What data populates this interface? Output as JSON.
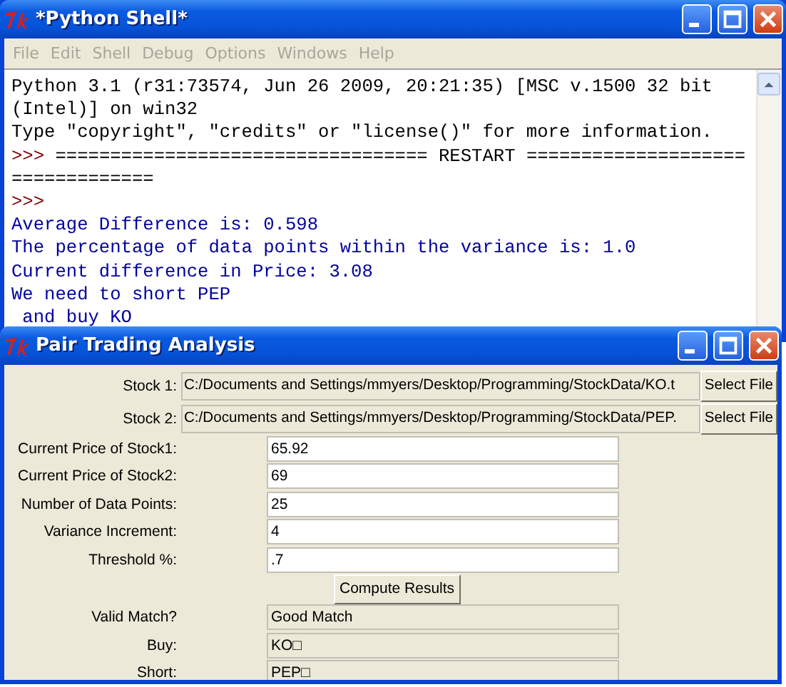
{
  "shell_window": {
    "title": "*Python Shell*",
    "menu": [
      "File",
      "Edit",
      "Shell",
      "Debug",
      "Options",
      "Windows",
      "Help"
    ],
    "lines": [
      {
        "kind": "info",
        "text": "Python 3.1 (r31:73574, Jun 26 2009, 20:21:35) [MSC v.1500 32 bit"
      },
      {
        "kind": "info",
        "text": "(Intel)] on win32"
      },
      {
        "kind": "info",
        "text": "Type \"copyright\", \"credits\" or \"license()\" for more information."
      },
      {
        "kind": "prompt",
        "prompt": ">>>",
        "text": "================================== RESTART ===================="
      },
      {
        "kind": "info",
        "text": "============="
      },
      {
        "kind": "prompt",
        "prompt": ">>>"
      },
      {
        "kind": "output",
        "text": "Average Difference is: 0.598"
      },
      {
        "kind": "output",
        "text": "The percentage of data points within the variance is: 1.0"
      },
      {
        "kind": "output",
        "text": "Current difference in Price: 3.08"
      },
      {
        "kind": "output",
        "text": "We need to short PEP"
      },
      {
        "kind": "output",
        "text": " and buy KO"
      }
    ]
  },
  "dialog": {
    "title": "Pair Trading Analysis",
    "files": [
      {
        "label": "Stock 1:",
        "path": "C:/Documents and Settings/mmyers/Desktop/Programming/StockData/KO.t",
        "button": "Select File"
      },
      {
        "label": "Stock 2:",
        "path": "C:/Documents and Settings/mmyers/Desktop/Programming/StockData/PEP.",
        "button": "Select File"
      }
    ],
    "inputs": [
      {
        "label": "Current Price of Stock1:",
        "value": "65.92"
      },
      {
        "label": "Current Price of Stock2:",
        "value": "69"
      },
      {
        "label": "Number of Data Points:",
        "value": "25"
      },
      {
        "label": "Variance Increment:",
        "value": "4"
      },
      {
        "label": "Threshold %:",
        "value": ".7"
      }
    ],
    "compute_button": "Compute Results",
    "results": [
      {
        "label": "Valid Match?",
        "value": "Good Match"
      },
      {
        "label": "Buy:",
        "value": "KO□"
      },
      {
        "label": "Short:",
        "value": "PEP□"
      }
    ]
  }
}
